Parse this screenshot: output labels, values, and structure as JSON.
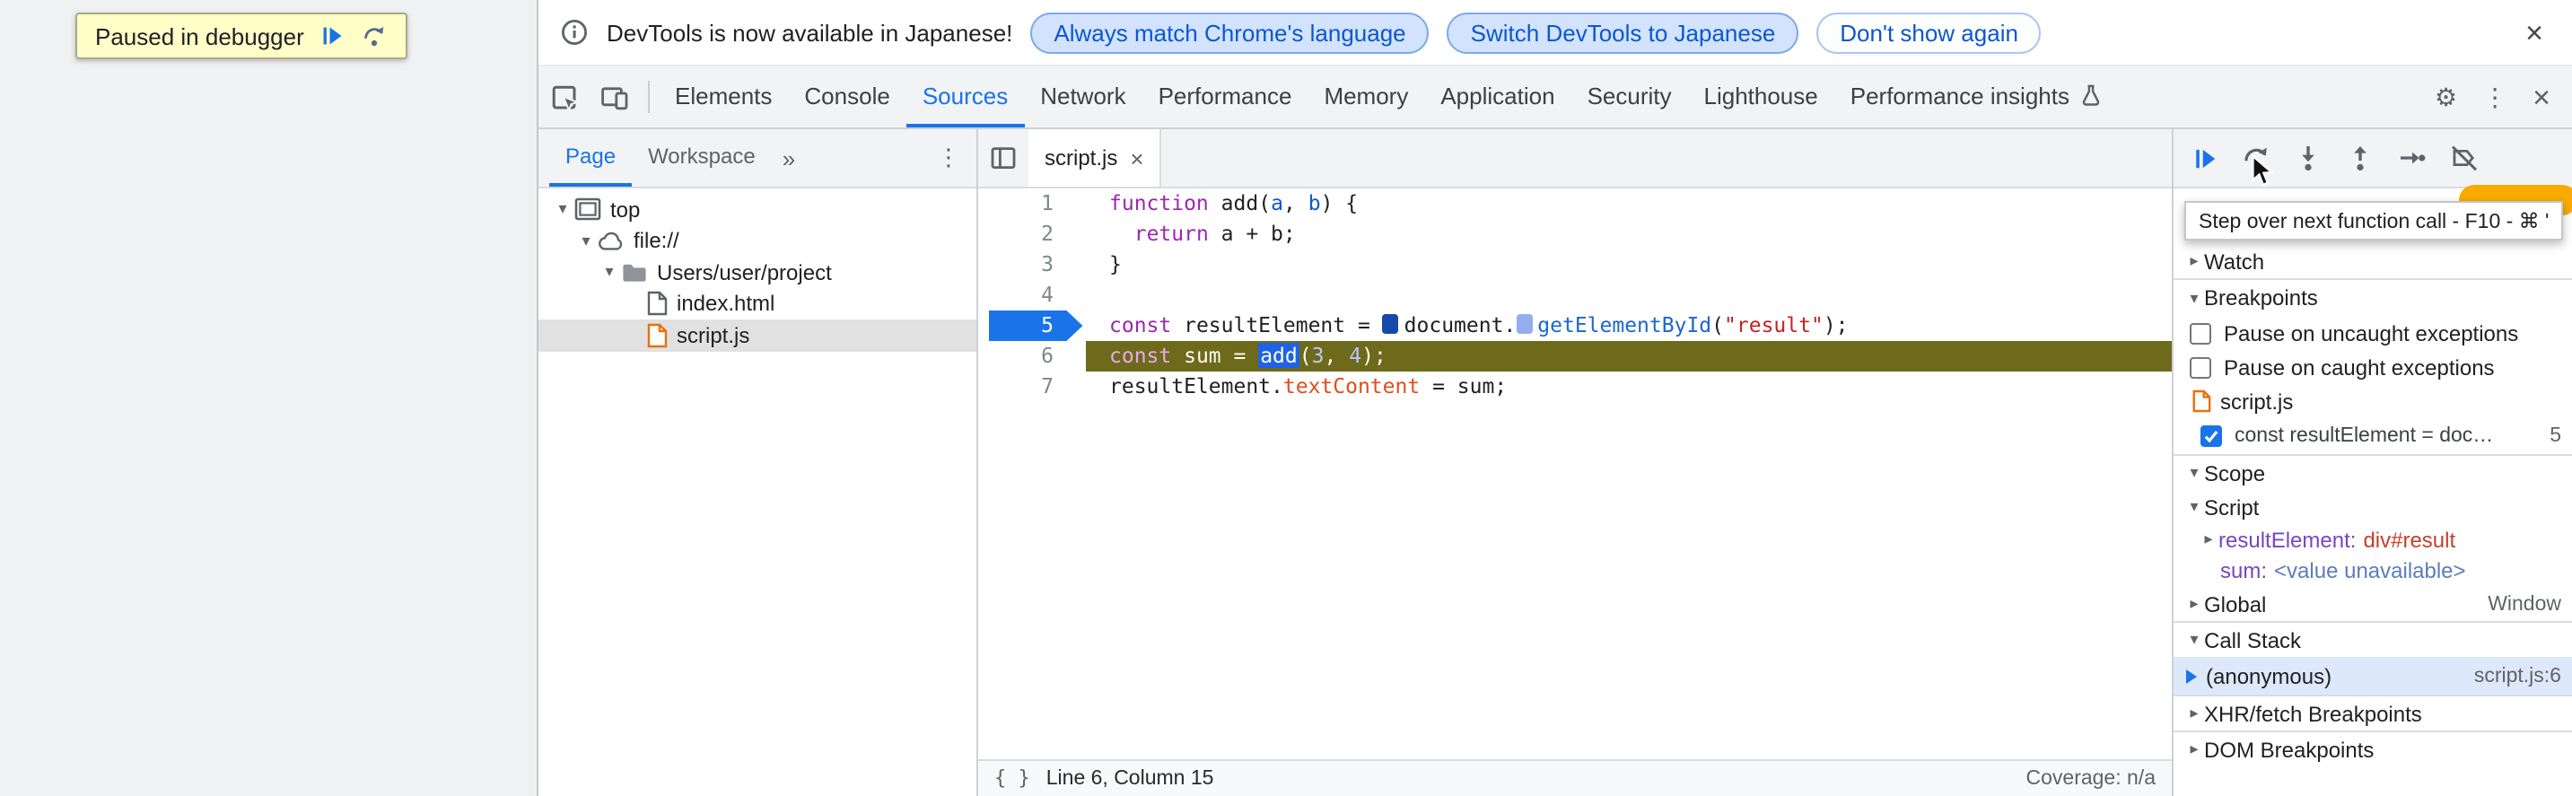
{
  "icons": {
    "tri_down": "▾",
    "tri_right": "▸",
    "overflow_chevrons": "»",
    "menu_dots": "⋮",
    "gear": "⚙",
    "close": "×",
    "braces": "{ }"
  },
  "page": {
    "paused_label": "Paused in debugger"
  },
  "infobar": {
    "message": "DevTools is now available in Japanese!",
    "button_match": "Always match Chrome's language",
    "button_switch": "Switch DevTools to Japanese",
    "button_dismiss": "Don't show again",
    "close": "×"
  },
  "toolbar": {
    "tabs": [
      "Elements",
      "Console",
      "Sources",
      "Network",
      "Performance",
      "Memory",
      "Application",
      "Security",
      "Lighthouse",
      "Performance insights"
    ],
    "active_tab": "Sources"
  },
  "nav": {
    "tab_page": "Page",
    "tab_workspace": "Workspace",
    "tree": [
      {
        "label": "top"
      },
      {
        "label": "file://"
      },
      {
        "label": "Users/user/project"
      },
      {
        "label": "index.html"
      },
      {
        "label": "script.js"
      }
    ]
  },
  "editor": {
    "tab_label": "script.js",
    "status_position": "Line 6, Column 15",
    "status_coverage": "Coverage: n/a",
    "lines": [
      {
        "num": 1,
        "tokens": [
          {
            "t": "function",
            "c": "kw"
          },
          {
            "t": " ",
            "c": "pln"
          },
          {
            "t": "add",
            "c": "def"
          },
          {
            "t": "(",
            "c": "pln"
          },
          {
            "t": "a",
            "c": "par"
          },
          {
            "t": ", ",
            "c": "pln"
          },
          {
            "t": "b",
            "c": "par"
          },
          {
            "t": ") {",
            "c": "pln"
          }
        ]
      },
      {
        "num": 2,
        "tokens": [
          {
            "t": "  ",
            "c": "pln"
          },
          {
            "t": "return",
            "c": "kw"
          },
          {
            "t": " a + b;",
            "c": "pln"
          }
        ]
      },
      {
        "num": 3,
        "tokens": [
          {
            "t": "}",
            "c": "pln"
          }
        ]
      },
      {
        "num": 4,
        "tokens": []
      },
      {
        "num": 5,
        "breakpoint": true,
        "tokens": [
          {
            "t": "const",
            "c": "kw"
          },
          {
            "t": " resultElement = ",
            "c": "pln"
          },
          {
            "m": "active"
          },
          {
            "t": "document.",
            "c": "pln"
          },
          {
            "m": "candidate"
          },
          {
            "t": "getElementById",
            "c": "fn"
          },
          {
            "t": "(",
            "c": "pln"
          },
          {
            "t": "\"result\"",
            "c": "str"
          },
          {
            "t": ");",
            "c": "pln"
          }
        ]
      },
      {
        "num": 6,
        "paused": true,
        "tokens": [
          {
            "t": "const",
            "c": "kw"
          },
          {
            "t": " sum = ",
            "c": "pln"
          },
          {
            "t": "add",
            "c": "fnsel"
          },
          {
            "t": "(",
            "c": "pln"
          },
          {
            "t": "3",
            "c": "num"
          },
          {
            "t": ", ",
            "c": "pln"
          },
          {
            "t": "4",
            "c": "num"
          },
          {
            "t": ");",
            "c": "pln"
          }
        ]
      },
      {
        "num": 7,
        "tokens": [
          {
            "t": "resultElement.",
            "c": "pln"
          },
          {
            "t": "textContent",
            "c": "prop"
          },
          {
            "t": " = sum;",
            "c": "pln"
          }
        ]
      }
    ]
  },
  "dbg": {
    "tooltip": "Step over next function call - F10 - ⌘ '",
    "watch": "Watch",
    "breakpoints": "Breakpoints",
    "pause_uncaught": "Pause on uncaught exceptions",
    "pause_caught": "Pause on caught exceptions",
    "bp_group_file": "script.js",
    "bp_entry_text": "const resultElement = doc…",
    "bp_entry_line": "5",
    "scope": "Scope",
    "scope_section": "Script",
    "vars": [
      {
        "name": "resultElement",
        "value": "div#result"
      },
      {
        "name": "sum",
        "value": "<value unavailable>"
      }
    ],
    "global_label": "Global",
    "global_value": "Window",
    "call_stack": "Call Stack",
    "frame_name": "(anonymous)",
    "frame_location": "script.js:6",
    "xhr_breakpoints": "XHR/fetch Breakpoints",
    "dom_breakpoints": "DOM Breakpoints"
  },
  "colors": {
    "accent": "#1a73e8",
    "paused_line": "#6e6a1b",
    "breakpoint": "#1a73e8",
    "banner_bg": "#ffffc8"
  }
}
